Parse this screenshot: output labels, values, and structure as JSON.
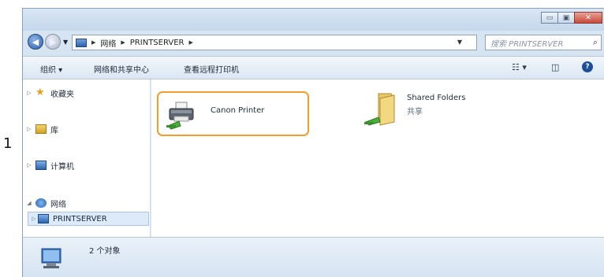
{
  "step_number": "1",
  "window": {
    "caption_buttons": {
      "minimize": "▭",
      "maximize": "▣",
      "close": "✕"
    }
  },
  "address_bar": {
    "segments": [
      "网络",
      "PRINTSERVER"
    ],
    "search_placeholder": "搜索 PRINTSERVER"
  },
  "toolbar": {
    "organize": "组织 ▾",
    "network_sharing": "网络和共享中心",
    "view_remote_printers": "查看远程打印机"
  },
  "sidebar": {
    "items": [
      {
        "label": "收藏夹",
        "icon": "star-icon"
      },
      {
        "label": "库",
        "icon": "library-icon"
      },
      {
        "label": "计算机",
        "icon": "computer-icon"
      },
      {
        "label": "网络",
        "icon": "network-icon"
      },
      {
        "label": "PRINTSERVER",
        "icon": "computer-icon"
      }
    ]
  },
  "content": {
    "items": [
      {
        "name": "Canon Printer",
        "type": "printer",
        "selected": true
      },
      {
        "name": "Shared Folders",
        "sub": "共享",
        "type": "shared-folder"
      }
    ]
  },
  "status": {
    "count_text": "2 个对象"
  },
  "colors": {
    "highlight_border": "#f0a028",
    "window_frame": "#d7e4f2",
    "selection_bg": "#dceaf9"
  }
}
